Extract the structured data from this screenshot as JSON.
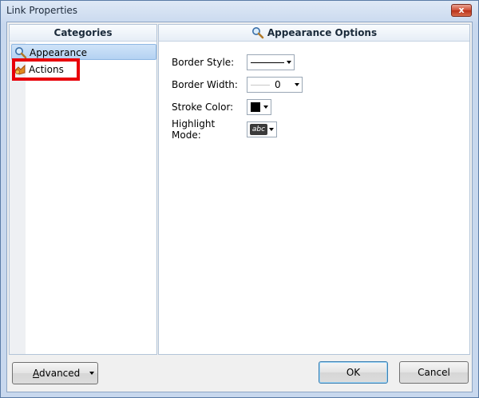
{
  "window": {
    "title": "Link Properties",
    "close_label": "x"
  },
  "categories": {
    "header": "Categories",
    "items": [
      {
        "label": "Appearance",
        "icon": "magnifier-icon",
        "selected": true
      },
      {
        "label": "Actions",
        "icon": "actions-icon",
        "selected": false
      }
    ],
    "highlight_color": "#e8000a"
  },
  "options": {
    "header": "Appearance Options",
    "border_style": {
      "label": "Border Style:"
    },
    "border_width": {
      "label": "Border Width:",
      "value": "0"
    },
    "stroke_color": {
      "label": "Stroke Color:",
      "value": "#000000"
    },
    "highlight_mode": {
      "label": "Highlight Mode:",
      "value": "abc"
    }
  },
  "buttons": {
    "advanced_first": "A",
    "advanced_rest": "dvanced",
    "ok": "OK",
    "cancel": "Cancel"
  },
  "colors": {
    "selection": "#b4d2f2",
    "title_bar": "#c8d8ee",
    "close": "#cf4c32"
  }
}
